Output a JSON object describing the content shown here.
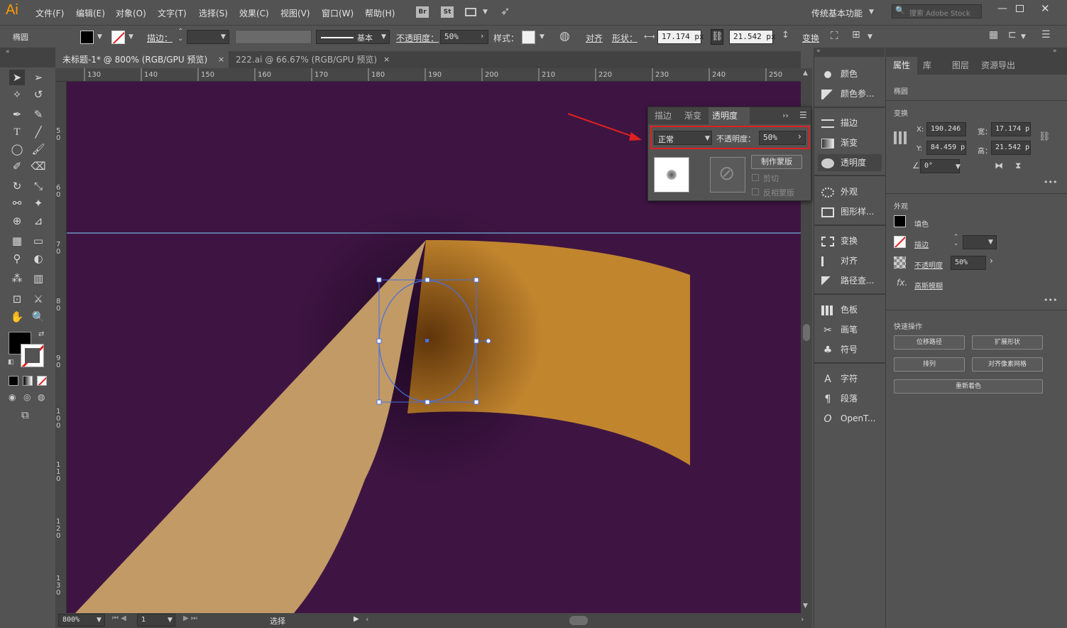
{
  "app": {
    "logo": "Ai"
  },
  "menu": {
    "items": [
      "文件(F)",
      "编辑(E)",
      "对象(O)",
      "文字(T)",
      "选择(S)",
      "效果(C)",
      "视图(V)",
      "窗口(W)",
      "帮助(H)"
    ],
    "br": "Br",
    "st": "St",
    "workspace": "传统基本功能",
    "search_placeholder": "搜索 Adobe Stock"
  },
  "control": {
    "object_type": "椭圆",
    "stroke_label": "描边：",
    "profile_label": "基本",
    "opacity_label": "不透明度：",
    "opacity_value": "50%",
    "style_label": "样式：",
    "align": "对齐",
    "shape": "形状：",
    "width": "17.174 px",
    "height": "21.542 px",
    "transform": "变换"
  },
  "tabs": [
    {
      "label": "未标题-1* @ 800% (RGB/GPU 预览)",
      "close": "×"
    },
    {
      "label": "222.ai @ 66.67% (RGB/GPU 预览)",
      "close": "×"
    }
  ],
  "ruler": {
    "top": [
      "130",
      "140",
      "150",
      "160",
      "170",
      "180",
      "190",
      "200",
      "210",
      "220",
      "230",
      "240",
      "250"
    ],
    "left": [
      "5 0",
      "6 0",
      "7 0",
      "8 0",
      "9 0",
      "1 0 0",
      "1 1 0",
      "1 2 0",
      "1 3 0"
    ]
  },
  "status": {
    "zoom": "800%",
    "page": "1",
    "tool": "选择"
  },
  "transparency_panel": {
    "tabs": [
      "描边",
      "渐变",
      "透明度"
    ],
    "blend_mode": "正常",
    "opacity_label": "不透明度：",
    "opacity_value": "50%",
    "make_mask": "制作蒙版",
    "clip": "剪切",
    "invert": "反相蒙版"
  },
  "dock": {
    "items": [
      "颜色",
      "颜色参...",
      "描边",
      "渐变",
      "透明度",
      "外观",
      "图形样...",
      "变换",
      "对齐",
      "路径查...",
      "色板",
      "画笔",
      "符号",
      "字符",
      "段落",
      "OpenT..."
    ]
  },
  "properties": {
    "tabs": [
      "属性",
      "库",
      "图层",
      "资源导出"
    ],
    "object": "椭圆",
    "transform_title": "变换",
    "x_label": "X:",
    "x": "190.246",
    "y_label": "Y:",
    "y": "84.459 p",
    "w_label": "宽：",
    "w": "17.174 p",
    "h_label": "高：",
    "h": "21.542 p",
    "angle": "0°",
    "appearance_title": "外观",
    "fill": "填色",
    "stroke": "描边",
    "opacity_label": "不透明度",
    "opacity": "50%",
    "effect": "高斯模糊",
    "fx": "fx.",
    "quick_title": "快速操作",
    "btn_offset": "位移路径",
    "btn_expand": "扩展形状",
    "btn_arrange": "排列",
    "btn_pixel": "对齐像素网格",
    "btn_recolor": "重新着色"
  },
  "colors": {
    "canvas": "#3e1542",
    "ribbon_light": "#c19a66",
    "ribbon_orange": "#c1852e",
    "selection": "#4a6fe0",
    "highlight": "#e02020",
    "guide": "#7fd2ff"
  }
}
